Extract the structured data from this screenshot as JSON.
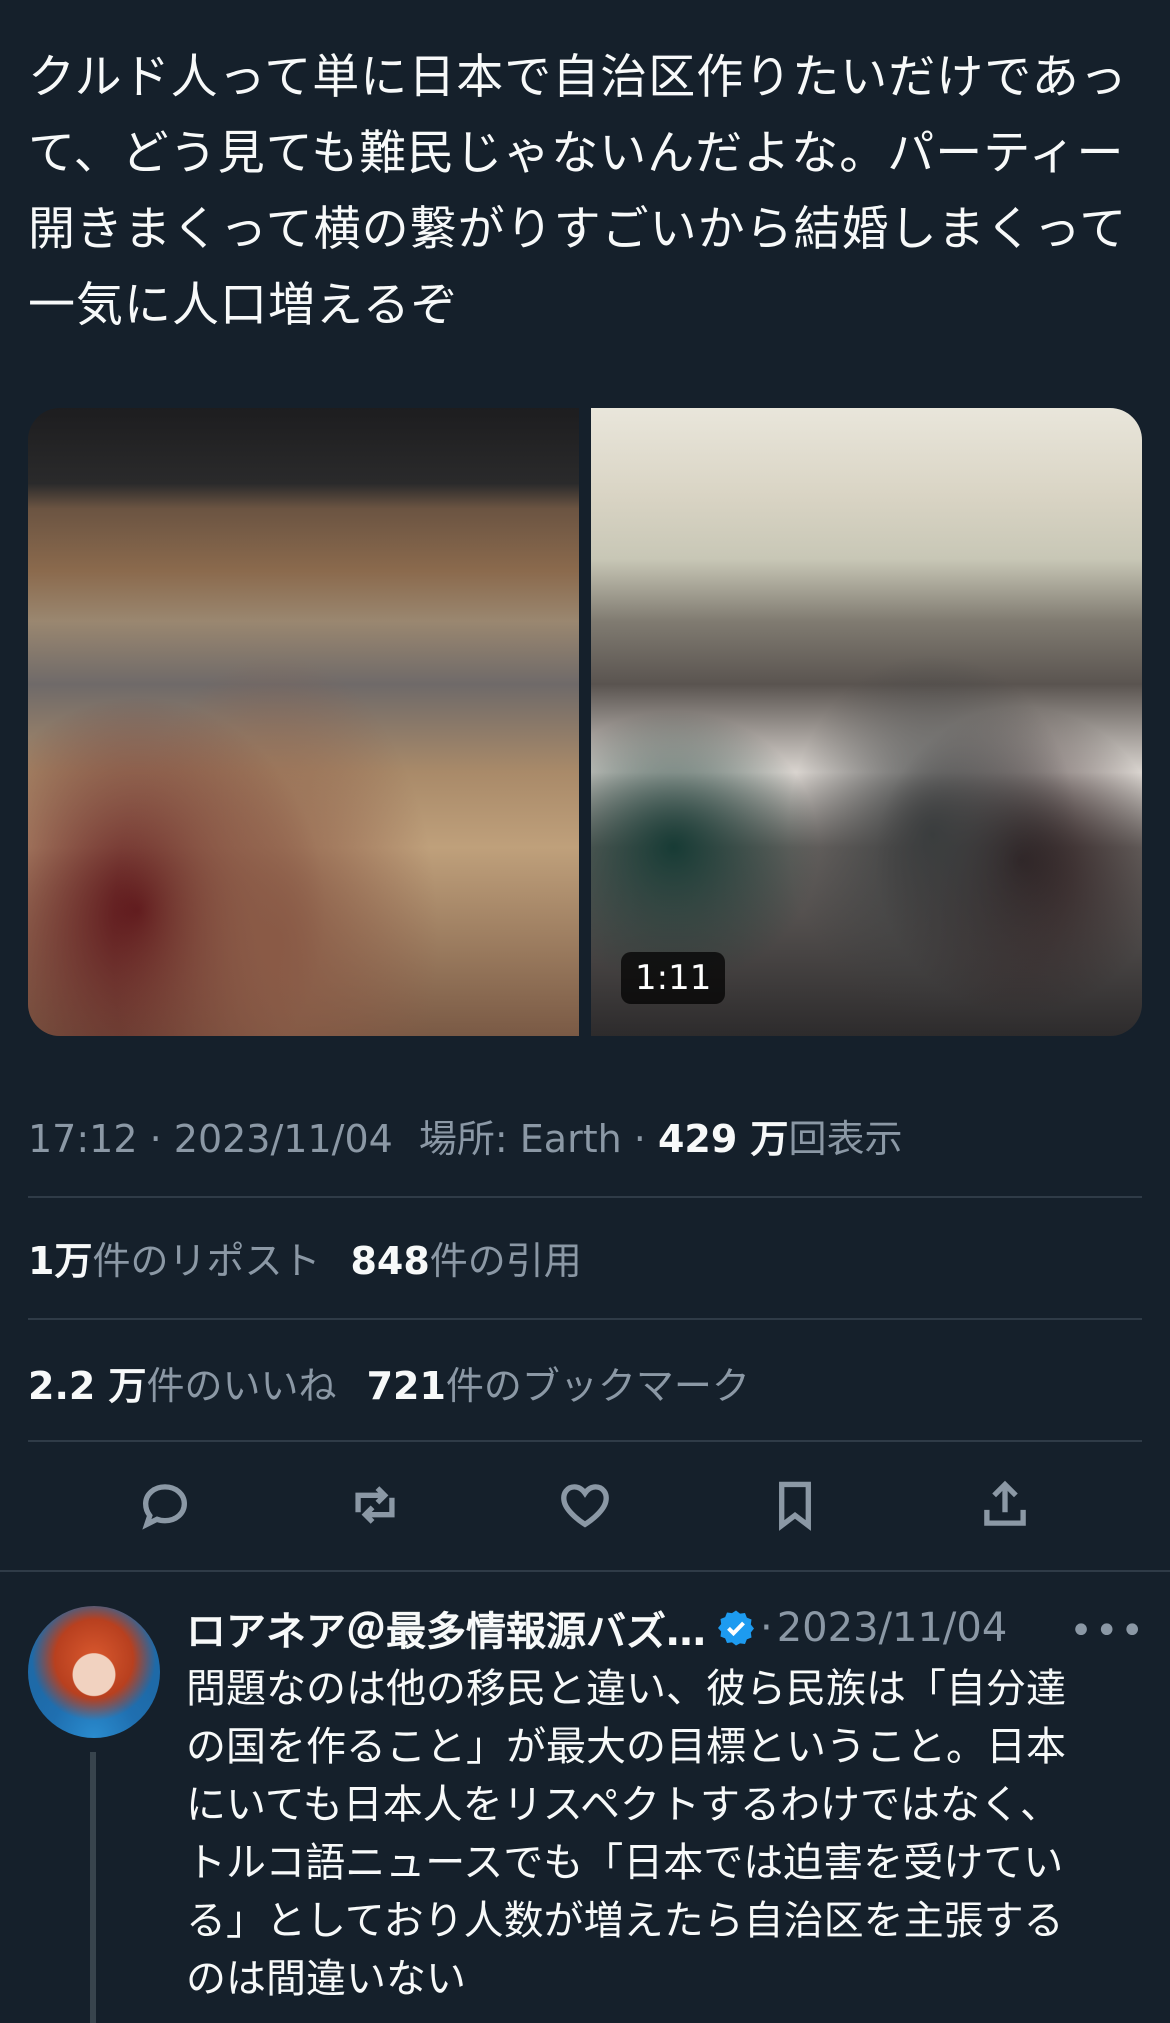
{
  "tweet": {
    "text": "クルド人って単に日本で自治区作りたいだけであっ\nて、どう見ても難民じゃないんだよな。パーティー\n開きまくって横の繋がりすごいから結婚しまくって\n一気に人口増えるぞ",
    "video_duration": "1:11",
    "time": "17:12",
    "date": "2023/11/04",
    "location_label": "場所: Earth",
    "views_count": "429 万",
    "views_label": "回表示",
    "reposts_count": "1万",
    "reposts_label": "件のリポスト",
    "quotes_count": "848",
    "quotes_label": "件の引用",
    "likes_count": "2.2 万",
    "likes_label": "件のいいね",
    "bookmarks_count": "721",
    "bookmarks_label": "件のブックマーク"
  },
  "actions": {
    "reply_icon": "reply-icon",
    "repost_icon": "repost-icon",
    "like_icon": "heart-icon",
    "bookmark_icon": "bookmark-icon",
    "share_icon": "share-icon"
  },
  "reply": {
    "name": "ロアネア＠最多情報源バズ…",
    "date": "2023/11/04",
    "text": "問題なのは他の移民と違い、彼ら民族は「自分達\nの国を作ること」が最大の目標ということ。日本\nにいても日本人をリスペクトするわけではなく、\nトルコ語ニュースでも「日本では迫害を受けてい\nる」としており人数が増えたら自治区を主張する\nのは間違いない"
  },
  "colors": {
    "background": "#15202b",
    "text": "#f7f9f9",
    "secondary": "#8b98a5",
    "divider": "#2f3b47",
    "verified": "#1d9bf0"
  }
}
